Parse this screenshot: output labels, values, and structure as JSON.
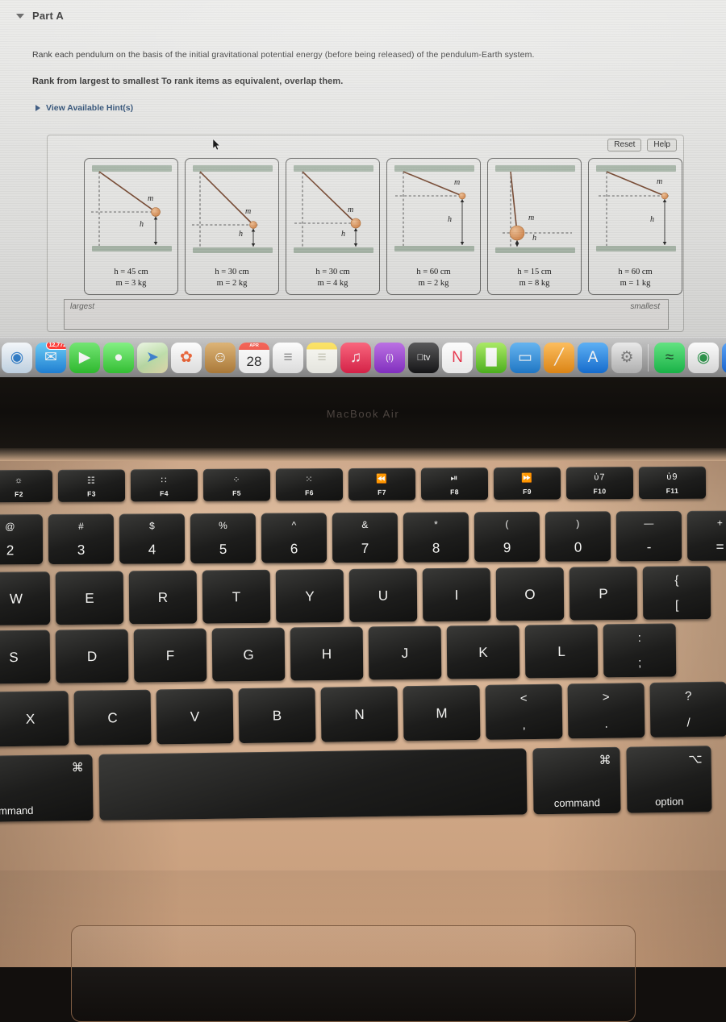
{
  "page": {
    "part_label": "Part A",
    "question": "Rank each pendulum on the basis of the initial gravitational potential energy (before being released) of the pendulum-Earth system.",
    "instruction": "Rank from largest to smallest To rank items as equivalent, overlap them.",
    "hint_link": "View Available Hint(s)",
    "reset_label": "Reset",
    "help_label": "Help",
    "rank_left": "largest",
    "rank_right": "smallest"
  },
  "pendulums": [
    {
      "h_label": "h = 45 cm",
      "m_label": "m = 3 kg",
      "mass_label": "m",
      "h_mark": "h",
      "h_cm": 45,
      "m_kg": 3,
      "style": "diagonal-mid"
    },
    {
      "h_label": "h = 30 cm",
      "m_label": "m = 2 kg",
      "mass_label": "m",
      "h_mark": "h",
      "h_cm": 30,
      "m_kg": 2,
      "style": "diagonal-low"
    },
    {
      "h_label": "h = 30 cm",
      "m_label": "m = 4 kg",
      "mass_label": "m",
      "h_mark": "h",
      "h_cm": 30,
      "m_kg": 4,
      "style": "diagonal-low-big"
    },
    {
      "h_label": "h = 60 cm",
      "m_label": "m = 2 kg",
      "mass_label": "m",
      "h_mark": "h",
      "h_cm": 60,
      "m_kg": 2,
      "style": "shallow-high"
    },
    {
      "h_label": "h = 15 cm",
      "m_label": "m = 8 kg",
      "mass_label": "m",
      "h_mark": "h",
      "h_cm": 15,
      "m_kg": 8,
      "style": "near-vertical"
    },
    {
      "h_label": "h = 60 cm",
      "m_label": "m = 1 kg",
      "mass_label": "m",
      "h_mark": "h",
      "h_cm": 60,
      "m_kg": 1,
      "style": "shallow-high-2"
    }
  ],
  "dock": {
    "items": [
      {
        "name": "safari-icon",
        "glyph": "◉",
        "bg": "linear-gradient(180deg,#f4f8fc,#cfe3f5)",
        "color": "#1f75c9",
        "running": false,
        "badge": ""
      },
      {
        "name": "mail-icon",
        "glyph": "✉",
        "bg": "linear-gradient(180deg,#4fc3f7,#1e88e5)",
        "color": "#ffffff",
        "running": true,
        "badge": "12,772"
      },
      {
        "name": "facetime-icon",
        "glyph": "▶",
        "bg": "linear-gradient(180deg,#5ae35a,#2ec92e)",
        "color": "#ffffff",
        "running": false,
        "badge": ""
      },
      {
        "name": "messages-icon",
        "glyph": "●",
        "bg": "linear-gradient(180deg,#6ef06e,#34d034)",
        "color": "#ffffff",
        "running": true,
        "badge": ""
      },
      {
        "name": "maps-icon",
        "glyph": "➤",
        "bg": "linear-gradient(150deg,#eaf6e0,#bfe3a8 55%,#f2e7b6)",
        "color": "#2f7ad1",
        "running": false,
        "badge": ""
      },
      {
        "name": "photos-icon",
        "glyph": "✿",
        "bg": "linear-gradient(180deg,#ffffff,#f2f2f2)",
        "color": "#f05a28",
        "running": false,
        "badge": ""
      },
      {
        "name": "contacts-icon",
        "glyph": "☺",
        "bg": "linear-gradient(180deg,#d9a85e,#b8823a)",
        "color": "#ffffff",
        "running": false,
        "badge": ""
      },
      {
        "name": "calendar-icon",
        "glyph": "28",
        "bg": "#ffffff",
        "color": "#2b2b2b",
        "running": false,
        "badge": "",
        "sub": "APR"
      },
      {
        "name": "reminders-icon",
        "glyph": "≡",
        "bg": "linear-gradient(180deg,#ffffff,#f0f0f0)",
        "color": "#888888",
        "running": false,
        "badge": ""
      },
      {
        "name": "notes-icon",
        "glyph": "≡",
        "bg": "linear-gradient(180deg,#ffe14d 0%,#ffe14d 22%,#fbfbf4 22%)",
        "color": "#c9c9b8",
        "running": true,
        "badge": ""
      },
      {
        "name": "music-icon",
        "glyph": "♫",
        "bg": "linear-gradient(180deg,#fb4a66,#e8204a)",
        "color": "#ffffff",
        "running": true,
        "badge": ""
      },
      {
        "name": "podcasts-icon",
        "glyph": "(i)",
        "bg": "linear-gradient(180deg,#b057e0,#8b2fd0)",
        "color": "#ffffff",
        "running": false,
        "badge": ""
      },
      {
        "name": "appletv-icon",
        "glyph": "tv",
        "bg": "linear-gradient(180deg,#3a3a3c,#111113)",
        "color": "#ffffff",
        "running": false,
        "badge": ""
      },
      {
        "name": "news-icon",
        "glyph": "N",
        "bg": "#ffffff",
        "color": "#f0253f",
        "running": false,
        "badge": ""
      },
      {
        "name": "numbers-icon",
        "glyph": "█",
        "bg": "linear-gradient(180deg,#9ce84a,#4fbe1b)",
        "color": "#ffffff",
        "running": false,
        "badge": ""
      },
      {
        "name": "keynote-icon",
        "glyph": "▭",
        "bg": "linear-gradient(180deg,#4aa8f0,#1d7fd6)",
        "color": "#ffffff",
        "running": false,
        "badge": ""
      },
      {
        "name": "pages-icon",
        "glyph": "╱",
        "bg": "linear-gradient(180deg,#ffb340,#f08f13)",
        "color": "#ffffff",
        "running": false,
        "badge": ""
      },
      {
        "name": "appstore-icon",
        "glyph": "A",
        "bg": "linear-gradient(180deg,#40a3f5,#1273e0)",
        "color": "#ffffff",
        "running": false,
        "badge": ""
      },
      {
        "name": "settings-icon",
        "glyph": "⚙",
        "bg": "linear-gradient(180deg,#e8e8e8,#bdbdbd)",
        "color": "#6f6f6f",
        "running": false,
        "badge": ""
      },
      {
        "name": "separator",
        "glyph": "",
        "bg": "",
        "color": "",
        "running": false,
        "badge": ""
      },
      {
        "name": "spotify-icon",
        "glyph": "≈",
        "bg": "linear-gradient(180deg,#46e06b,#17c24a)",
        "color": "#05250f",
        "running": true,
        "badge": ""
      },
      {
        "name": "chrome-icon",
        "glyph": "◉",
        "bg": "linear-gradient(180deg,#fdfdfd,#e9e9e9)",
        "color": "#1a8f3c",
        "running": true,
        "badge": ""
      },
      {
        "name": "zoom-icon",
        "glyph": "▶",
        "bg": "linear-gradient(180deg,#3a92f5,#1769e0)",
        "color": "#ffffff",
        "running": true,
        "badge": ""
      }
    ]
  },
  "laptop": {
    "model": "MacBook Air"
  },
  "keyboard": {
    "function_row": [
      {
        "key": "F2",
        "icon": "☼",
        "label": "F2",
        "name": "brightness-up"
      },
      {
        "key": "F3",
        "icon": "☷",
        "label": "F3",
        "name": "mission-control"
      },
      {
        "key": "F4",
        "icon": "∷",
        "label": "F4",
        "name": "launchpad"
      },
      {
        "key": "F5",
        "icon": "⁘",
        "label": "F5",
        "name": "keyboard-brightness-down"
      },
      {
        "key": "F6",
        "icon": "⁙",
        "label": "F6",
        "name": "keyboard-brightness-up"
      },
      {
        "key": "F7",
        "icon": "⏪",
        "label": "F7",
        "name": "rewind"
      },
      {
        "key": "F8",
        "icon": "⏯",
        "label": "F8",
        "name": "play-pause"
      },
      {
        "key": "F9",
        "icon": "⏩",
        "label": "F9",
        "name": "fast-forward"
      },
      {
        "key": "F10",
        "icon": "ὐ7",
        "label": "F10",
        "name": "mute"
      },
      {
        "key": "F11",
        "icon": "ὐ9",
        "label": "F11",
        "name": "volume-down"
      }
    ],
    "number_row": [
      {
        "top": "@",
        "bot": "2"
      },
      {
        "top": "#",
        "bot": "3"
      },
      {
        "top": "$",
        "bot": "4"
      },
      {
        "top": "%",
        "bot": "5"
      },
      {
        "top": "^",
        "bot": "6"
      },
      {
        "top": "&",
        "bot": "7"
      },
      {
        "top": "*",
        "bot": "8"
      },
      {
        "top": "(",
        "bot": "9"
      },
      {
        "top": ")",
        "bot": "0"
      },
      {
        "top": "—",
        "bot": "-"
      },
      {
        "top": "+",
        "bot": "="
      }
    ],
    "row_q": [
      "W",
      "E",
      "R",
      "T",
      "Y",
      "U",
      "I",
      "O",
      "P",
      "{\n["
    ],
    "row_a": [
      "S",
      "D",
      "F",
      "G",
      "H",
      "J",
      "K",
      "L",
      ":\n;"
    ],
    "row_z": [
      "X",
      "C",
      "V",
      "B",
      "N",
      "M",
      "<\n,",
      ">\n.",
      "?\n/"
    ],
    "bottom_row": [
      {
        "sym": "⌘",
        "name": "command",
        "label": "command"
      },
      {
        "sym": "",
        "name": "space",
        "label": ""
      },
      {
        "sym": "⌘",
        "name": "command",
        "label": "command"
      },
      {
        "sym": "⌥",
        "name": "option",
        "label": "option"
      }
    ]
  }
}
